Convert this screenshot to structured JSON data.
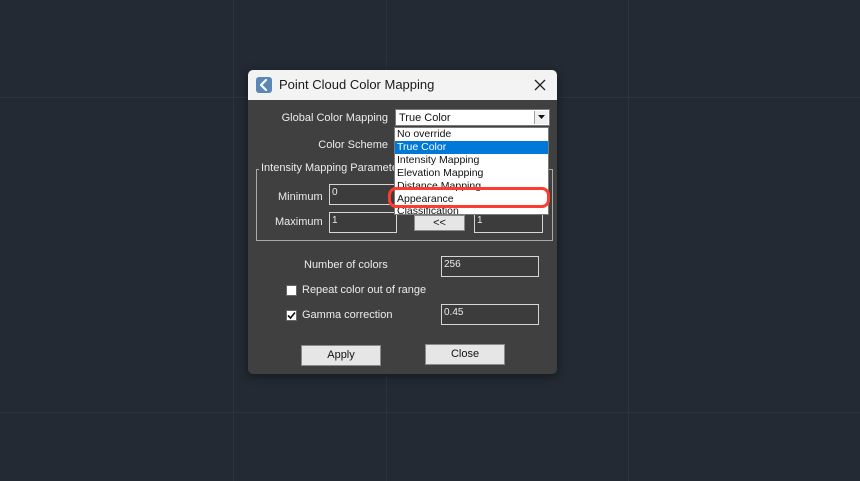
{
  "dialog": {
    "title": "Point Cloud Color Mapping",
    "icon": "back-arrow-icon",
    "close_icon": "close-icon"
  },
  "form": {
    "global_color_mapping_label": "Global Color Mapping",
    "global_color_mapping_value": "True Color",
    "color_scheme_label": "Color Scheme",
    "intensity_group_title": "Intensity Mapping Paramete",
    "minimum_label": "Minimum",
    "minimum_value": "0",
    "maximum_label": "Maximum",
    "maximum_value": "1",
    "swap_button_label": "<<",
    "right_field_value": "1",
    "number_of_colors_label": "Number of colors",
    "number_of_colors_value": "256",
    "repeat_color_label": "Repeat color out of range",
    "repeat_color_checked": false,
    "gamma_label": "Gamma correction",
    "gamma_checked": true,
    "gamma_value": "0.45",
    "apply_label": "Apply",
    "close_label": "Close"
  },
  "dropdown": {
    "options": [
      {
        "label": "No override",
        "selected": false
      },
      {
        "label": "True Color",
        "selected": true
      },
      {
        "label": "Intensity Mapping",
        "selected": false
      },
      {
        "label": "Elevation Mapping",
        "selected": false
      },
      {
        "label": "Distance Mapping",
        "selected": false
      },
      {
        "label": "Appearance",
        "selected": false
      },
      {
        "label": "Classification",
        "selected": false
      }
    ],
    "highlighted_option": "Appearance"
  },
  "colors": {
    "background": "#232a33",
    "dialog_body": "#404040",
    "selection": "#0078d7",
    "highlight_ring": "#ff3b30"
  }
}
